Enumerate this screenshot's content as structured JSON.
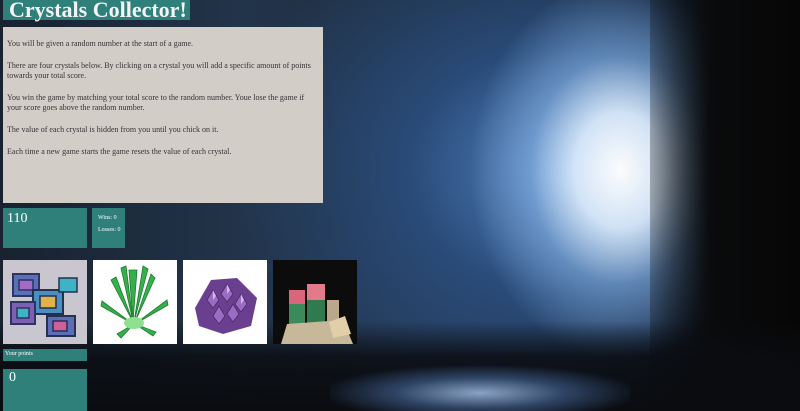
{
  "header": {
    "title": "Crystals Collector!"
  },
  "instructions": [
    "You will be given a random number at the start of a game.",
    "There are four crystals below. By clicking on a crystal you will add a specific amount of points towards your total score.",
    "You win the game by matching your total score to the random number. Youe lose the game if your score goes above the random number.",
    "The value of each crystal is hidden from you until you chick on it.",
    "Each time a new game starts the game resets the value of each crystal."
  ],
  "game": {
    "random_number": "110",
    "wins": "Wins: 0",
    "losses": "Losses: 0",
    "points_label": "Your points",
    "total_score": "0"
  },
  "crystals": [
    {
      "icon": "bismuth-crystal-icon",
      "color": "#6a7bb5"
    },
    {
      "icon": "green-crystal-icon",
      "color": "#2fae47"
    },
    {
      "icon": "amethyst-crystal-icon",
      "color": "#7b4fa0"
    },
    {
      "icon": "tourmaline-crystal-icon",
      "color": "#d46a7a"
    }
  ],
  "theme": {
    "panel_color": "#2f7f7b",
    "instructions_bg": "#d3cdc8"
  }
}
